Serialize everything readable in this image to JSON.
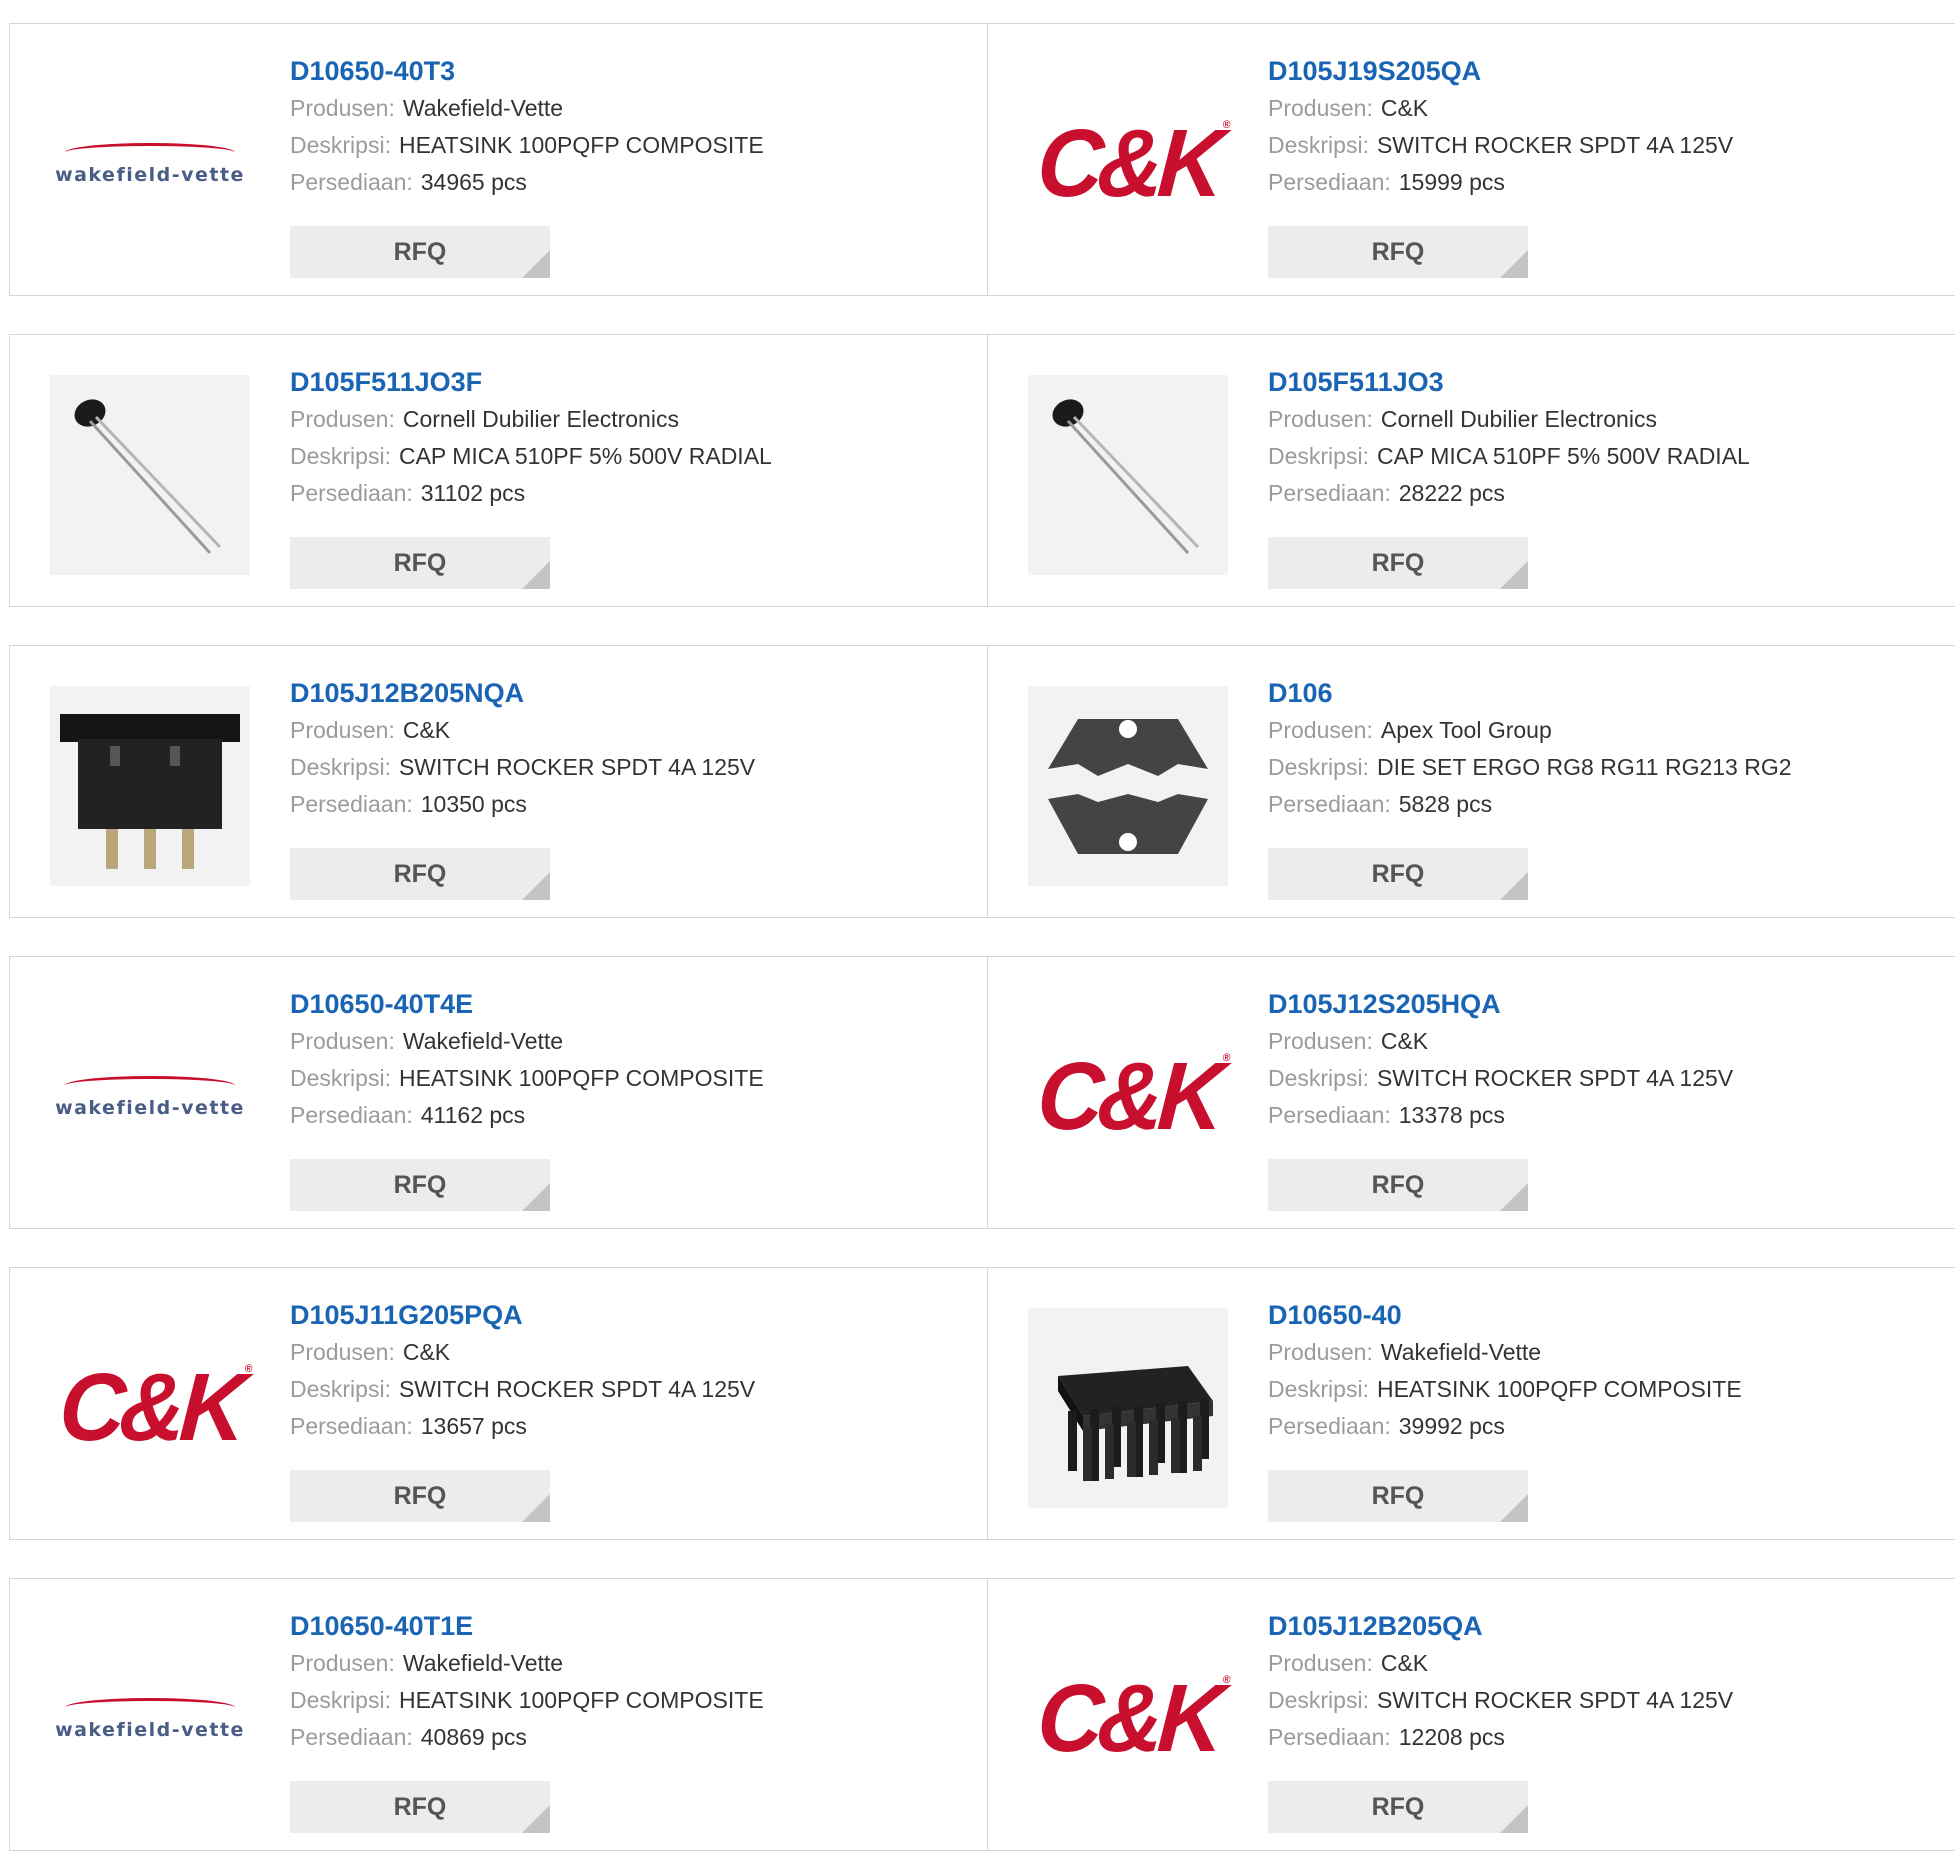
{
  "labels": {
    "manufacturer": "Produsen:",
    "description": "Deskripsi:",
    "stock": "Persediaan:"
  },
  "rfq_label": "RFQ",
  "products": [
    {
      "part": "D10650-40T3",
      "manufacturer": "Wakefield-Vette",
      "description": "HEATSINK 100PQFP COMPOSITE",
      "stock": "34965 pcs",
      "image": "wakefield-vette-logo"
    },
    {
      "part": "D105J19S205QA",
      "manufacturer": "C&K",
      "description": "SWITCH ROCKER SPDT 4A 125V",
      "stock": "15999 pcs",
      "image": "ck-logo"
    },
    {
      "part": "D105F511JO3F",
      "manufacturer": "Cornell Dubilier Electronics",
      "description": "CAP MICA 510PF 5% 500V RADIAL",
      "stock": "31102 pcs",
      "image": "capacitor-photo"
    },
    {
      "part": "D105F511JO3",
      "manufacturer": "Cornell Dubilier Electronics",
      "description": "CAP MICA 510PF 5% 500V RADIAL",
      "stock": "28222 pcs",
      "image": "capacitor-photo"
    },
    {
      "part": "D105J12B205NQA",
      "manufacturer": "C&K",
      "description": "SWITCH ROCKER SPDT 4A 125V",
      "stock": "10350 pcs",
      "image": "rocker-switch-photo"
    },
    {
      "part": "D106",
      "manufacturer": "Apex Tool Group",
      "description": "DIE SET ERGO RG8 RG11 RG213 RG2",
      "stock": "5828 pcs",
      "image": "die-set-photo"
    },
    {
      "part": "D10650-40T4E",
      "manufacturer": "Wakefield-Vette",
      "description": "HEATSINK 100PQFP COMPOSITE",
      "stock": "41162 pcs",
      "image": "wakefield-vette-logo"
    },
    {
      "part": "D105J12S205HQA",
      "manufacturer": "C&K",
      "description": "SWITCH ROCKER SPDT 4A 125V",
      "stock": "13378 pcs",
      "image": "ck-logo"
    },
    {
      "part": "D105J11G205PQA",
      "manufacturer": "C&K",
      "description": "SWITCH ROCKER SPDT 4A 125V",
      "stock": "13657 pcs",
      "image": "ck-logo"
    },
    {
      "part": "D10650-40",
      "manufacturer": "Wakefield-Vette",
      "description": "HEATSINK 100PQFP COMPOSITE",
      "stock": "39992 pcs",
      "image": "heatsink-photo"
    },
    {
      "part": "D10650-40T1E",
      "manufacturer": "Wakefield-Vette",
      "description": "HEATSINK 100PQFP COMPOSITE",
      "stock": "40869 pcs",
      "image": "wakefield-vette-logo"
    },
    {
      "part": "D105J12B205QA",
      "manufacturer": "C&K",
      "description": "SWITCH ROCKER SPDT 4A 125V",
      "stock": "12208 pcs",
      "image": "ck-logo"
    }
  ],
  "brand_text": {
    "ck": "C&K",
    "ck_mark": "®",
    "wakefield": "wakefield-vette"
  }
}
